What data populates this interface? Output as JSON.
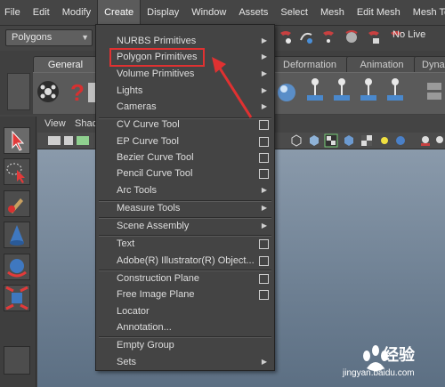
{
  "menubar": {
    "items": [
      "File",
      "Edit",
      "Modify",
      "Create",
      "Display",
      "Window",
      "Assets",
      "Select",
      "Mesh",
      "Edit Mesh",
      "Mesh Tools"
    ],
    "active": "Create"
  },
  "status_line": {
    "mode_select": "Polygons",
    "live_label": "No Live"
  },
  "shelf": {
    "tabs": [
      "General",
      "Deformation",
      "Animation",
      "Dyna"
    ]
  },
  "panel": {
    "menu": [
      "View",
      "Shac"
    ]
  },
  "create_menu": {
    "items": [
      {
        "label": "NURBS Primitives",
        "kind": "submenu"
      },
      {
        "label": "Polygon Primitives",
        "kind": "submenu"
      },
      {
        "label": "Volume Primitives",
        "kind": "submenu"
      },
      {
        "label": "Lights",
        "kind": "submenu"
      },
      {
        "label": "Cameras",
        "kind": "submenu"
      },
      {
        "label": "CV Curve Tool",
        "kind": "option"
      },
      {
        "label": "EP Curve Tool",
        "kind": "option"
      },
      {
        "label": "Bezier Curve Tool",
        "kind": "option"
      },
      {
        "label": "Pencil Curve Tool",
        "kind": "option"
      },
      {
        "label": "Arc Tools",
        "kind": "submenu"
      },
      {
        "label": "Measure Tools",
        "kind": "submenu"
      },
      {
        "label": "Scene Assembly",
        "kind": "submenu"
      },
      {
        "label": "Text",
        "kind": "option"
      },
      {
        "label": "Adobe(R) Illustrator(R) Object...",
        "kind": "option"
      },
      {
        "label": "Construction Plane",
        "kind": "option"
      },
      {
        "label": "Free Image Plane",
        "kind": "option"
      },
      {
        "label": "Locator",
        "kind": "plain"
      },
      {
        "label": "Annotation...",
        "kind": "plain"
      },
      {
        "label": "Empty Group",
        "kind": "plain"
      },
      {
        "label": "Sets",
        "kind": "submenu"
      }
    ],
    "highlighted": "Polygon Primitives"
  },
  "watermark": {
    "brand": "经验",
    "url": "jingyan.baidu.com"
  },
  "colors": {
    "annotation_red": "#e03131",
    "menu_bg": "#444444",
    "viewport": "#7c8da0"
  }
}
